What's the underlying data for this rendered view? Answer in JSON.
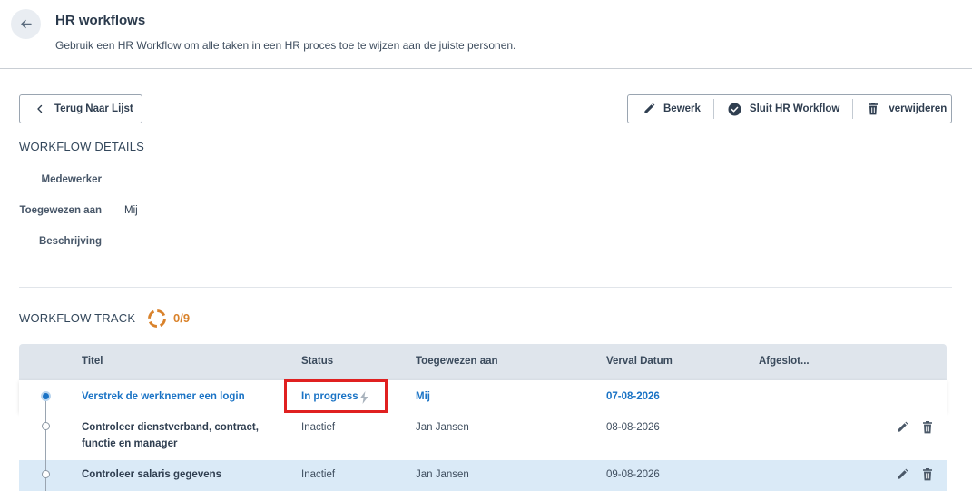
{
  "header": {
    "title": "HR workflows",
    "subtitle": "Gebruik een HR Workflow om alle taken in een HR proces toe te wijzen aan de juiste personen."
  },
  "toolbar": {
    "back_to_list": "Terug Naar Lijst",
    "edit": "Bewerk",
    "close_workflow": "Sluit HR Workflow",
    "delete": "verwijderen"
  },
  "details": {
    "section_title": "WORKFLOW DETAILS",
    "employee_label": "Medewerker",
    "employee_value": "",
    "assigned_label": "Toegewezen aan",
    "assigned_value": "Mij",
    "description_label": "Beschrijving",
    "description_value": ""
  },
  "track": {
    "section_title": "WORKFLOW TRACK",
    "progress": "0/9",
    "progress_fraction": 0,
    "accent_color": "#d9822b"
  },
  "table": {
    "columns": [
      "Titel",
      "Status",
      "Toegewezen aan",
      "Verval Datum",
      "Afgeslot..."
    ],
    "rows": [
      {
        "title": "Verstrek de werknemer een login",
        "status": "In progress",
        "assignee": "Mij",
        "due": "07-08-2026",
        "closed": ""
      },
      {
        "title": "Controleer dienstverband, contract, functie en manager",
        "status": "Inactief",
        "assignee": "Jan Jansen",
        "due": "08-08-2026",
        "closed": ""
      },
      {
        "title": "Controleer salaris gegevens",
        "status": "Inactief",
        "assignee": "Jan Jansen",
        "due": "09-08-2026",
        "closed": ""
      }
    ]
  },
  "colors": {
    "link": "#1a73c5",
    "highlight_border": "#e02020",
    "selected_row": "#daeaf7"
  }
}
